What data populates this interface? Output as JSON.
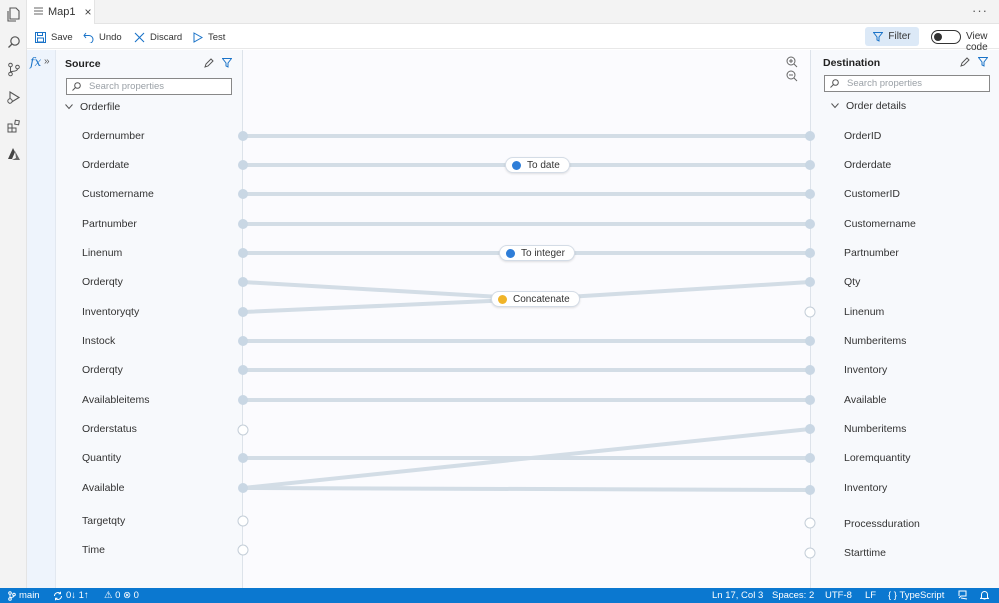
{
  "tab": {
    "title": "Map1"
  },
  "toolbar": {
    "save_label": "Save",
    "undo_label": "Undo",
    "discard_label": "Discard",
    "test_label": "Test",
    "filter_label": "Filter",
    "view_code_label": "View code"
  },
  "source": {
    "title": "Source",
    "search_placeholder": "Search properties",
    "group": "Orderfile",
    "items": [
      "Ordernumber",
      "Orderdate",
      "Customername",
      "Partnumber",
      "Linenum",
      "Orderqty",
      "Inventoryqty",
      "Instock",
      "Orderqty",
      "Availableitems",
      "Orderstatus",
      "Quantity",
      "Available",
      "Targetqty",
      "Time"
    ]
  },
  "destination": {
    "title": "Destination",
    "search_placeholder": "Search properties",
    "group": "Order details",
    "items": [
      "OrderID",
      "Orderdate",
      "CustomerID",
      "Customername",
      "Partnumber",
      "Qty",
      "Linenum",
      "Numberitems",
      "Inventory",
      "Available",
      "Numberitems",
      "Loremquantity",
      "Inventory",
      "Processduration",
      "Starttime"
    ]
  },
  "functions": {
    "to_date": "To date",
    "to_integer": "To integer",
    "concatenate": "Concatenate"
  },
  "status": {
    "branch": "main",
    "sync": "0↓ 1↑",
    "problems": "⚠ 0 ⊗ 0",
    "position": "Ln 17, Col 3",
    "spaces": "Spaces: 2",
    "encoding": "UTF-8",
    "eol": "LF",
    "language": "{ } TypeScript"
  },
  "colors": {
    "accent": "#0b78d0",
    "line": "#d3dde6",
    "node": "#c9d7e4",
    "to_date_dot": "#2f7ed8",
    "concat_dot": "#f0b429"
  }
}
